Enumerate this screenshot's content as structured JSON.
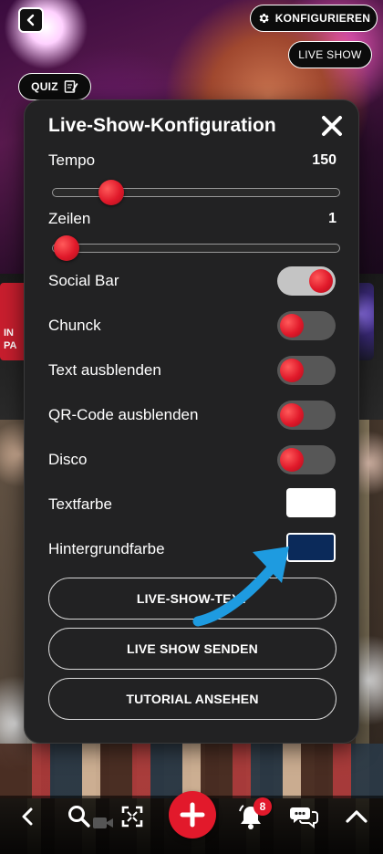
{
  "header": {
    "configure_label": "KONFIGURIEREN",
    "live_show_label": "LIVE SHOW",
    "quiz_label": "QUIZ"
  },
  "background": {
    "left_tile_text": "IN\nPA"
  },
  "modal": {
    "title": "Live-Show-Konfiguration",
    "tempo": {
      "label": "Tempo",
      "value": "150",
      "level": 0.17
    },
    "rows": {
      "label": "Zeilen",
      "value": "1",
      "level": 0.0
    },
    "toggles": [
      {
        "label": "Social Bar",
        "on": true
      },
      {
        "label": "Chunck",
        "on": false
      },
      {
        "label": "Text ausblenden",
        "on": false
      },
      {
        "label": "QR-Code ausblenden",
        "on": false
      },
      {
        "label": "Disco",
        "on": false
      }
    ],
    "text_color": {
      "label": "Textfarbe",
      "color": "#ffffff"
    },
    "background_color": {
      "label": "Hintergrundfarbe",
      "color": "#0b2a5a"
    },
    "buttons": {
      "live_show_text": "LIVE-SHOW-TEXT",
      "send_live_show": "LIVE SHOW SENDEN",
      "watch_tutorial": "TUTORIAL ANSEHEN"
    }
  },
  "bottom_bar": {
    "notification_count": "8"
  },
  "colors": {
    "accent_red": "#e2192b",
    "annotation_arrow": "#1e9be0"
  }
}
